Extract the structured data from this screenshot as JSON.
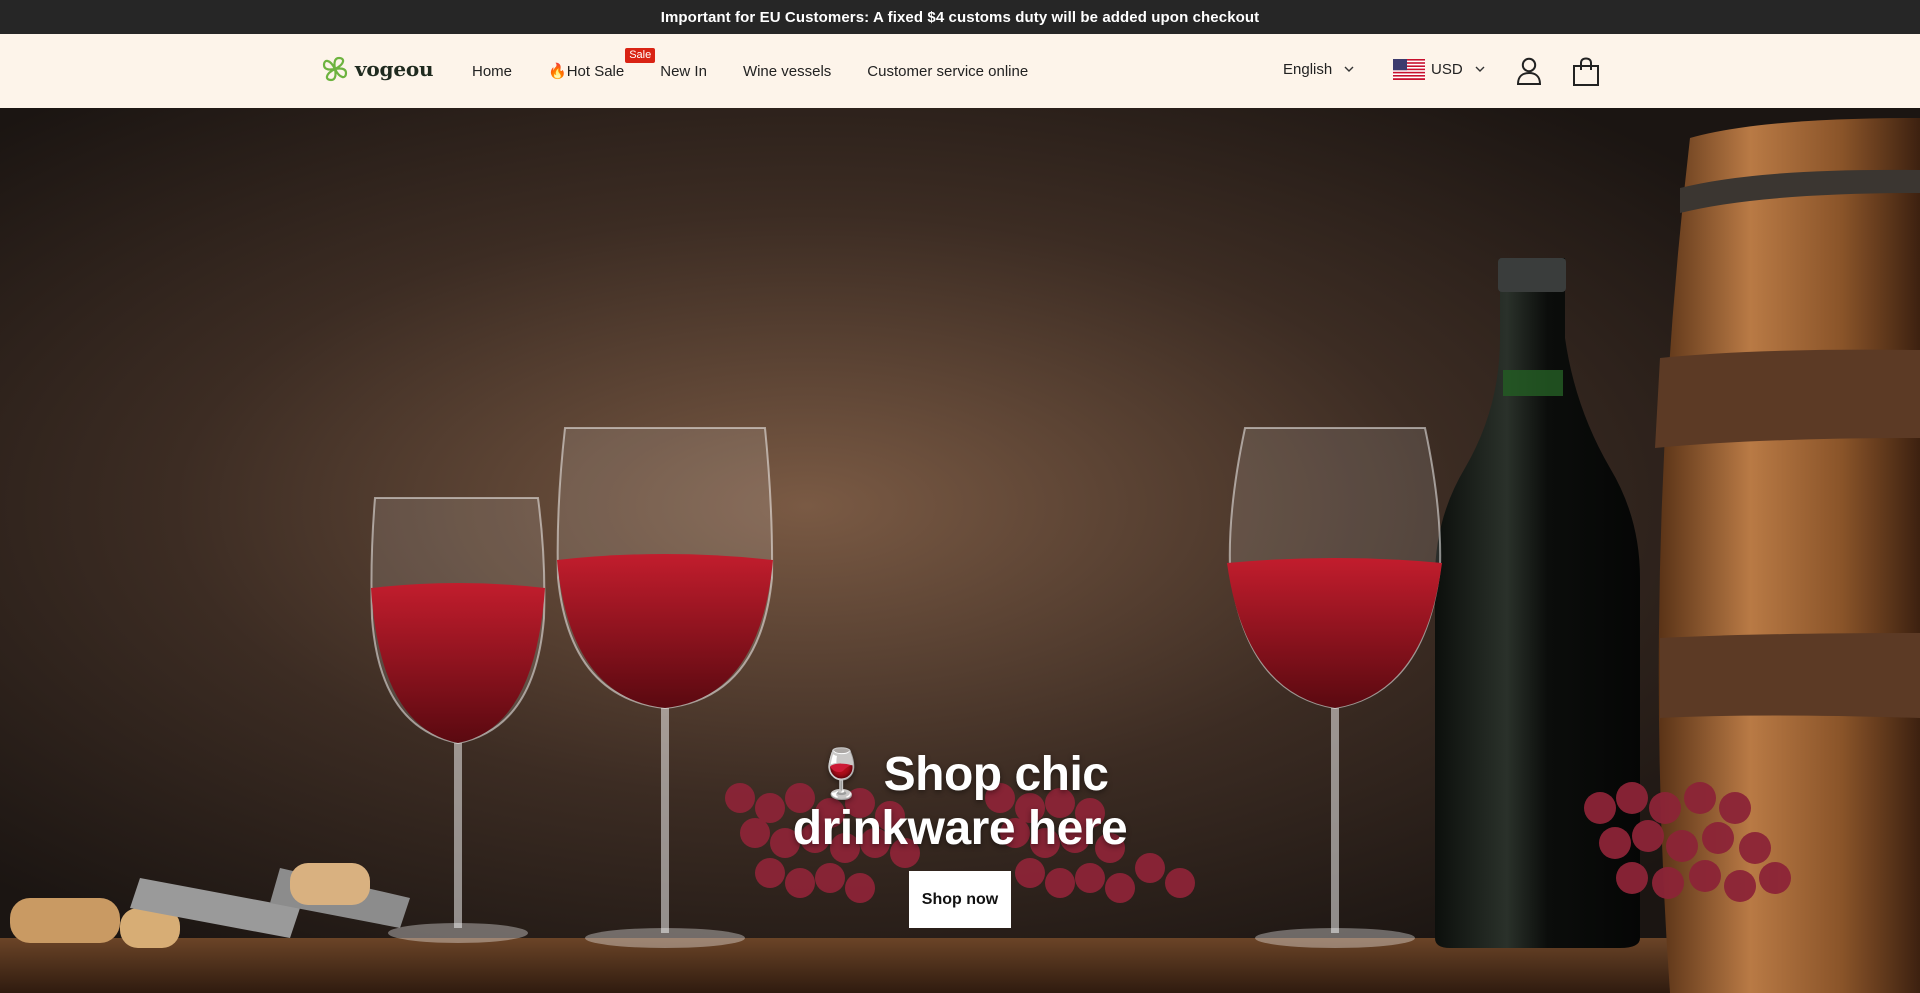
{
  "announcement": {
    "text": "Important for EU Customers: A fixed $4 customs duty will be added upon checkout"
  },
  "header": {
    "logo_text": "vogeou",
    "nav": [
      {
        "label": "Home"
      },
      {
        "label": "Hot Sale",
        "prefix_icon": "flame",
        "badge": "Sale"
      },
      {
        "label": "New In"
      },
      {
        "label": "Wine vessels"
      },
      {
        "label": "Customer service online"
      }
    ],
    "language": "English",
    "currency": "USD",
    "currency_flag": "us-flag-icon"
  },
  "hero": {
    "title": "Shop chic drinkware here",
    "title_emoji": "wine-glass",
    "cta_label": "Shop now"
  },
  "colors": {
    "announcement_bg": "#262626",
    "header_bg": "#fdf4ea",
    "sale_badge": "#d92314",
    "wine": "#9c0f1c"
  }
}
